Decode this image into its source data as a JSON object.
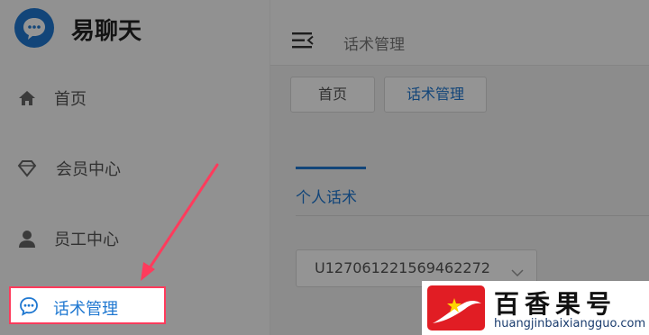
{
  "app": {
    "name": "易聊天",
    "brand_color": "#1f78d1",
    "highlight_color": "#ff3b5c"
  },
  "sidebar": {
    "items": [
      {
        "label": "首页",
        "icon": "home-icon"
      },
      {
        "label": "会员中心",
        "icon": "diamond-icon"
      },
      {
        "label": "员工中心",
        "icon": "user-icon"
      },
      {
        "label": "话术管理",
        "icon": "chat-bubble-icon",
        "active": true
      }
    ]
  },
  "header": {
    "title": "话术管理",
    "menu_icon": "menu-toggle-icon"
  },
  "tabs": [
    {
      "label": "首页"
    },
    {
      "label": "话术管理",
      "current": true
    }
  ],
  "main": {
    "subtab": "个人话术",
    "select": {
      "value": "U127061221569462272",
      "icon": "chevron-down-icon"
    }
  },
  "watermark": {
    "title": "百香果号",
    "url": "huangjinbaixiangguo.com"
  }
}
